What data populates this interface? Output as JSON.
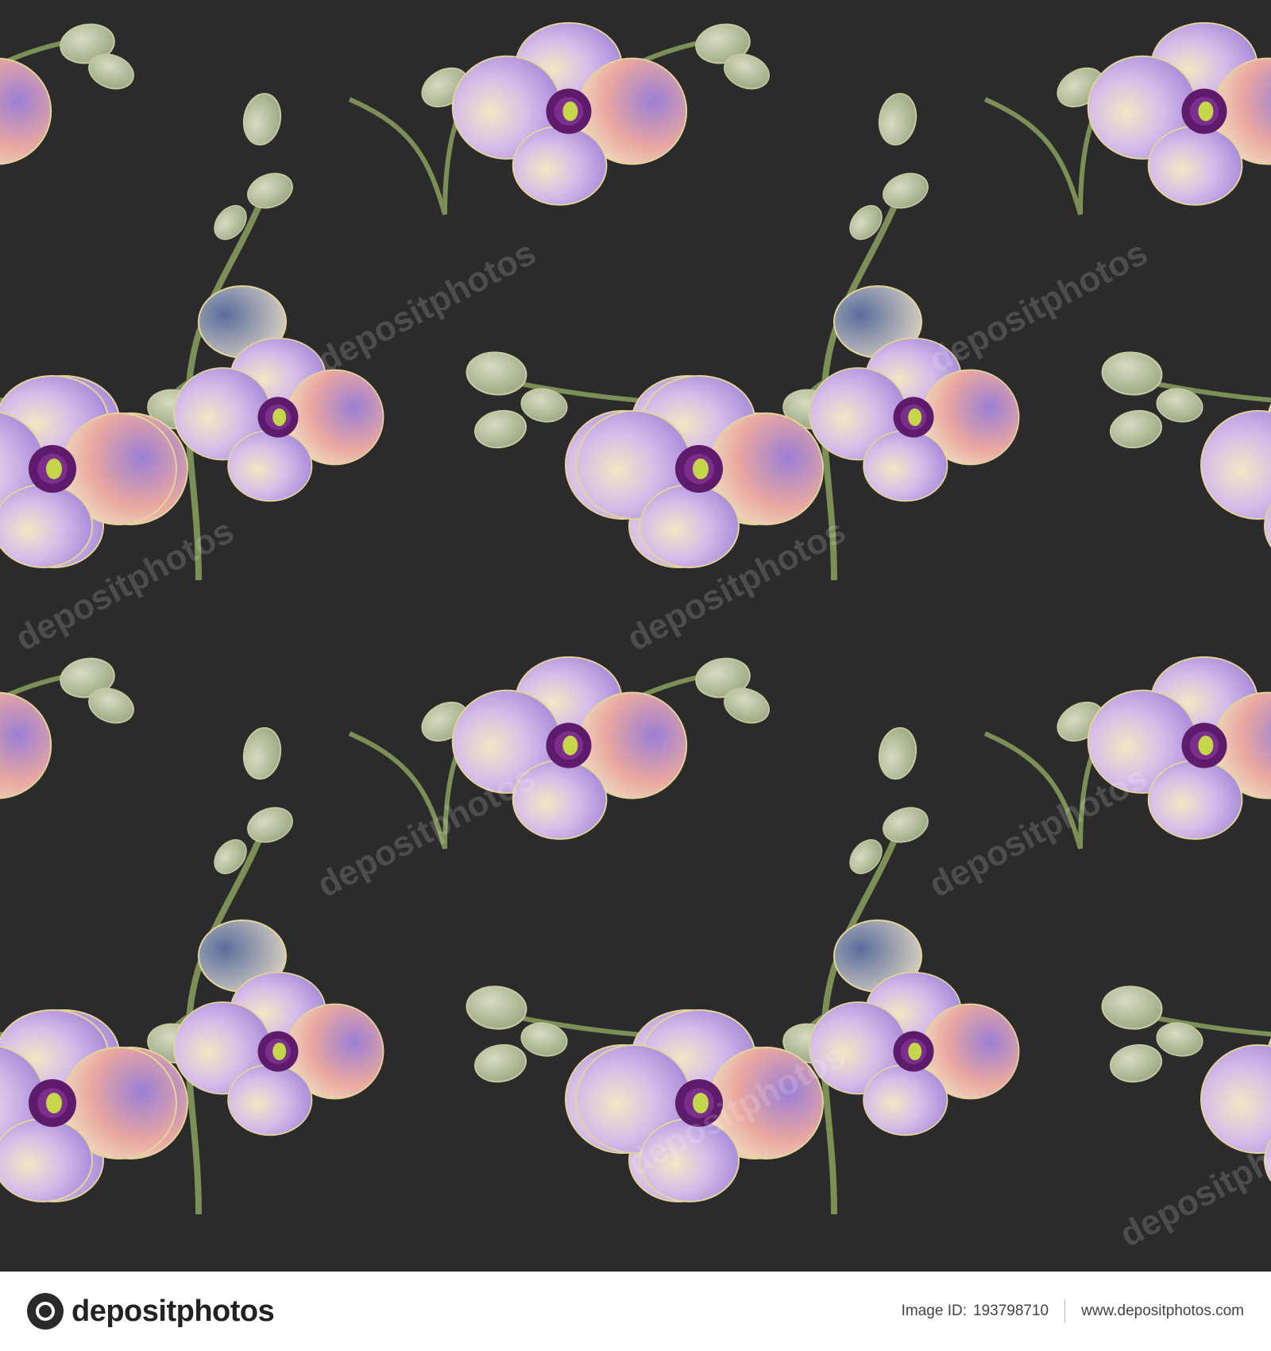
{
  "image": {
    "subject": "watercolor orchid seamless pattern",
    "colors": {
      "background": "#2b2b2b",
      "petal_violet": "#9b7fd6",
      "petal_cream": "#f2e7c4",
      "petal_blush": "#e8a7a0",
      "center_purple": "#5e1a6b",
      "center_yellow": "#c4d64a",
      "bud_green": "#8fa07a",
      "stem_green": "#7c8f56",
      "blue_petal": "#5a6e9c"
    }
  },
  "watermark": {
    "text": "depositphotos"
  },
  "footer": {
    "logo_text": "depositphotos",
    "image_id_label": "Image ID:",
    "image_id": "193798710",
    "url": "www.depositphotos.com"
  }
}
